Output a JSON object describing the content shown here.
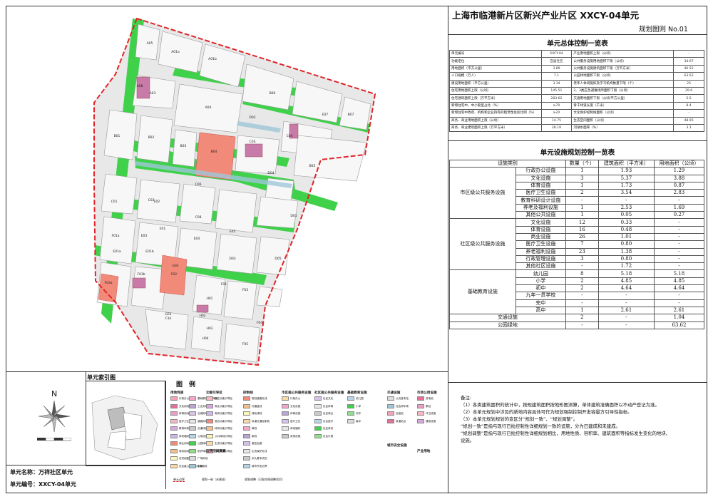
{
  "title": "上海市临港新片区新兴产业片区 XXCY-04单元",
  "subtitle": "规划图则 No.01",
  "summary_table": {
    "title": "单元总体控制一览表",
    "left": [
      {
        "label": "单元编号",
        "value": "XXCY-04"
      },
      {
        "label": "功能定位",
        "value": "宜居社区"
      },
      {
        "label": "用地面积（平方公里）",
        "value": "3.89"
      },
      {
        "label": "人口规模（万人）",
        "value": "7.1"
      },
      {
        "label": "建设用地面积（平方公里）",
        "value": "3.34"
      },
      {
        "label": "住宅用地面积上限（公顷）",
        "value": "145.51"
      },
      {
        "label": "住宅建筑面积上限（万平方米）",
        "value": "283.62"
      },
      {
        "label": "新增住宅中，中小套型占比（%）",
        "value": "≥70"
      },
      {
        "label": "新增住宅中政府、机构和企业持有的租赁性住房比例（%）",
        "value": "≥20"
      },
      {
        "label": "商务、商业用地面积上限（公顷）",
        "value": "14.75"
      },
      {
        "label": "商务、商业建筑面积上限（万平方米）",
        "value": "28.19"
      }
    ],
    "right": [
      {
        "label": "产业用地面积上限（公顷）",
        "value": "-"
      },
      {
        "label": "公共服务设施用地面积下限（公顷）",
        "value": "34.67"
      },
      {
        "label": "公共服务设施建筑面积下限（万平方米）",
        "value": "46.52"
      },
      {
        "label": "公园绿地面积下限（公顷）",
        "value": "63.62"
      },
      {
        "label": "老年人休闲锻炼及学习机构数量下限（个）",
        "value": "25"
      },
      {
        "label": "2、3类应急避难场所面积下限（公顷）",
        "value": "29.6"
      },
      {
        "label": "交通用地面积下限（公顷/平方公里）",
        "value": "5.5"
      },
      {
        "label": "骨干绿道长度（千米）",
        "value": "8.4"
      },
      {
        "label": "文化保护控制线面积（公顷）",
        "value": "-"
      },
      {
        "label": "生态空间面积（公顷）",
        "value": "48.95"
      },
      {
        "label": "河湖水面率（%）",
        "value": "3.1"
      }
    ]
  },
  "facility_table": {
    "title": "单元设施规划控制一览表",
    "headers": [
      "设施类别",
      "数量（个）",
      "建筑面积（平方米）",
      "用地面积（公顷）"
    ],
    "groups": [
      {
        "name": "市区级公共服务设施",
        "rows": [
          [
            "行政办公设施",
            "1",
            "1.93",
            "1.29"
          ],
          [
            "文化设施",
            "3",
            "5.37",
            "3.88"
          ],
          [
            "体育设施",
            "1",
            "1.73",
            "0.87"
          ],
          [
            "医疗卫生设施",
            "2",
            "3.54",
            "2.83"
          ],
          [
            "教育科研设计设施",
            "-",
            "-",
            "-"
          ],
          [
            "养老及福利设施",
            "1",
            "2.53",
            "1.69"
          ],
          [
            "其他公共设施",
            "1",
            "0.05",
            "0.27"
          ]
        ]
      },
      {
        "name": "社区级公共服务设施",
        "rows": [
          [
            "文化设施",
            "12",
            "0.33",
            "-"
          ],
          [
            "体育设施",
            "16",
            "0.48",
            "-"
          ],
          [
            "商业设施",
            "26",
            "1.01",
            "-"
          ],
          [
            "医疗卫生设施",
            "7",
            "0.80",
            "-"
          ],
          [
            "养老福利设施",
            "23",
            "1.38",
            "-"
          ],
          [
            "行政管理设施",
            "3",
            "0.80",
            "-"
          ],
          [
            "其他社区设施",
            "-",
            "1.72",
            "-"
          ]
        ]
      },
      {
        "name": "基础教育设施",
        "rows": [
          [
            "幼儿园",
            "8",
            "5.18",
            "5.18"
          ],
          [
            "小学",
            "2",
            "4.85",
            "4.85"
          ],
          [
            "初中",
            "2",
            "4.64",
            "4.64"
          ],
          [
            "九年一贯学校",
            "-",
            "-",
            "-"
          ],
          [
            "完中",
            "-",
            "-",
            "-"
          ],
          [
            "高中",
            "1",
            "2.61",
            "2.61"
          ]
        ]
      }
    ],
    "footer_rows": [
      [
        "交通设施",
        "2",
        "-",
        "1.04"
      ],
      [
        "公园绿地",
        "-",
        "-",
        "63.62"
      ]
    ]
  },
  "notes": {
    "title": "备注:",
    "lines": [
      "（1）各类建筑面积的统计中，按规建筑面积按地形图测算，单体建筑准确面积以不动产登记为准。",
      "（2）本单元规划中涉及的新地内容具体可作为规划强制控制开发容量方引导性指标。",
      "（3）本单元规划规划的变区分“规划一致”、“规划调整”。",
      "“规划一致”是指与现行已批控制性详细规划一致的设施，分为已建成和未建成。",
      "“规划调整”是指与现行已批控制性详细规划相比，用地性质、容积率、建筑面积等指标发生变化的地块、",
      "设施。"
    ]
  },
  "index_map": {
    "title": "单元索引图"
  },
  "legend": {
    "title": "图　例",
    "columns": [
      {
        "title": "用地性质",
        "items": [
          "行政办公用地",
          "文化用地",
          "体育用地",
          "医疗卫生用地",
          "教育科研用地",
          "养老福利用地",
          "商业用地",
          "商务用地",
          "住宅组团用地",
          "社区级公共服务设施用地",
          "基础教育设施用地",
          "工业用地",
          "仓储用地",
          "道路用地",
          "交通场站用地",
          "公用设施用地",
          "公园绿地",
          "防护绿地",
          "广场用地",
          "水域"
        ]
      },
      {
        "title": "功能引导区",
        "items": [
          "居住功能引导区",
          "商业功能引导区",
          "商务功能引导区",
          "混合功能引导区",
          "科研功能引导区",
          "公共绿地引导区",
          "生态功能引导区",
          "特色风貌引导区"
        ]
      },
      {
        "title": "控制线",
        "items": [
          "规划道路红线",
          "河道蓝线",
          "绿化绿线",
          "轨道交通控制线",
          "黄线",
          "紫线",
          "高压走廊",
          "生态保护红线",
          "永久基本农田",
          "城市开发边界"
        ]
      },
      {
        "title": "市区级公共服务设施",
        "items": [
          "行政办公",
          "文化设施",
          "体育设施",
          "医疗卫生",
          "养老福利",
          "其他设施"
        ]
      },
      {
        "title": "社区级公共服务设施",
        "items": [
          "社区文化",
          "社区体育",
          "社区商业",
          "社区医疗",
          "社区养老",
          "社区行政"
        ]
      },
      {
        "title": "基础教育设施",
        "items": [
          "幼儿园",
          "小学",
          "初中",
          "高中"
        ]
      },
      {
        "title": "交通设施",
        "items": [
          "公交首末站",
          "社会停车场",
          "加油站",
          "轨道站点"
        ]
      },
      {
        "title": "市政公用设施",
        "items": [
          "变电站",
          "泵站",
          "环卫设施",
          "通信设施"
        ]
      }
    ],
    "sub_titles": [
      "公共空间要素",
      "城市安全设施",
      "产业用地"
    ],
    "bottom_labels": [
      "单元边界",
      "规划一致（未建成）",
      "规划调整（已批控规调整项目）"
    ]
  },
  "unit_name": "单元名称：万祥社区单元",
  "unit_code": "单元编号：XXCY-04单元",
  "compass_label": "N",
  "parcels": [
    {
      "code": "A05",
      "use": "residential"
    },
    {
      "code": "A01a",
      "use": "residential"
    },
    {
      "code": "A01b",
      "use": "residential"
    },
    {
      "code": "A03",
      "use": "residential"
    },
    {
      "code": "A04",
      "use": "residential"
    },
    {
      "code": "A08",
      "use": "community"
    },
    {
      "code": "B01",
      "use": "residential"
    },
    {
      "code": "B02",
      "use": "residential"
    },
    {
      "code": "B03",
      "use": "residential"
    },
    {
      "code": "B04",
      "use": "commercial"
    },
    {
      "code": "B05",
      "use": "residential"
    },
    {
      "code": "B06",
      "use": "residential"
    },
    {
      "code": "B07",
      "use": "residential"
    },
    {
      "code": "C01",
      "use": "residential"
    },
    {
      "code": "C02",
      "use": "residential"
    },
    {
      "code": "C03",
      "use": "residential"
    },
    {
      "code": "C04",
      "use": "residential"
    },
    {
      "code": "C06",
      "use": "residential"
    },
    {
      "code": "D01",
      "use": "residential"
    },
    {
      "code": "D02",
      "use": "residential"
    },
    {
      "code": "D03",
      "use": "residential"
    },
    {
      "code": "D04",
      "use": "residential"
    },
    {
      "code": "D05",
      "use": "residential"
    },
    {
      "code": "E01",
      "use": "residential"
    },
    {
      "code": "E02",
      "use": "residential"
    },
    {
      "code": "E03",
      "use": "residential"
    },
    {
      "code": "E04",
      "use": "residential"
    },
    {
      "code": "E05",
      "use": "residential"
    },
    {
      "code": "E07",
      "use": "residential"
    },
    {
      "code": "F01",
      "use": "residential"
    },
    {
      "code": "F02",
      "use": "residential"
    },
    {
      "code": "F03",
      "use": "residential"
    },
    {
      "code": "F04",
      "use": "residential"
    },
    {
      "code": "F05",
      "use": "residential"
    },
    {
      "code": "F01a",
      "use": "residential"
    },
    {
      "code": "F03a",
      "use": "commercial"
    },
    {
      "code": "F03b",
      "use": "residential"
    },
    {
      "code": "E01a",
      "use": "residential"
    },
    {
      "code": "E01b",
      "use": "residential"
    },
    {
      "code": "G01",
      "use": "residential"
    },
    {
      "code": "G02",
      "use": "commercial"
    },
    {
      "code": "H01",
      "use": "residential"
    },
    {
      "code": "H02",
      "use": "residential"
    },
    {
      "code": "H03",
      "use": "residential"
    },
    {
      "code": "H04",
      "use": "residential"
    },
    {
      "code": "F34",
      "use": "residential"
    },
    {
      "code": "C08",
      "use": "residential"
    }
  ],
  "colors": {
    "green": "#3fd14a",
    "road": "#ffffff",
    "parcel": "#f4f4f4",
    "commercial": "#f28a79",
    "boundary": "#e0242a",
    "water": "#9fc7d9",
    "community": "#c87aa8"
  }
}
